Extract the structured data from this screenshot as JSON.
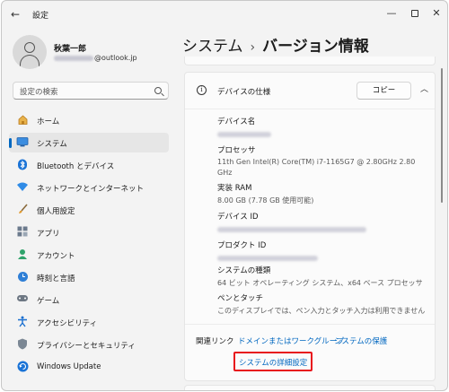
{
  "window": {
    "title": "設定"
  },
  "profile": {
    "name": "秋葉一郎",
    "email_domain": "@outlook.jp"
  },
  "search": {
    "placeholder": "設定の検索"
  },
  "sidebar": {
    "items": [
      {
        "label": "ホーム",
        "icon": "home-icon"
      },
      {
        "label": "システム",
        "icon": "system-icon"
      },
      {
        "label": "Bluetooth とデバイス",
        "icon": "bluetooth-icon"
      },
      {
        "label": "ネットワークとインターネット",
        "icon": "wifi-icon"
      },
      {
        "label": "個人用設定",
        "icon": "brush-icon"
      },
      {
        "label": "アプリ",
        "icon": "apps-icon"
      },
      {
        "label": "アカウント",
        "icon": "account-icon"
      },
      {
        "label": "時刻と言語",
        "icon": "time-language-icon"
      },
      {
        "label": "ゲーム",
        "icon": "gamepad-icon"
      },
      {
        "label": "アクセシビリティ",
        "icon": "accessibility-icon"
      },
      {
        "label": "プライバシーとセキュリティ",
        "icon": "shield-icon"
      },
      {
        "label": "Windows Update",
        "icon": "update-icon"
      }
    ]
  },
  "breadcrumb": {
    "parent": "システム",
    "separator": "›",
    "current": "バージョン情報"
  },
  "device_specs": {
    "title": "デバイスの仕様",
    "copy_label": "コピー",
    "device_name_label": "デバイス名",
    "processor_label": "プロセッサ",
    "processor_line1": "11th Gen Intel(R) Core(TM) i7-1165G7 @ 2.80GHz   2.80",
    "processor_line2": "GHz",
    "ram_label": "実装 RAM",
    "ram_value": "8.00 GB (7.78 GB 使用可能)",
    "device_id_label": "デバイス ID",
    "product_id_label": "プロダクト ID",
    "system_type_label": "システムの種類",
    "system_type_value": "64 ビット オペレーティング システム、x64 ベース プロセッサ",
    "pen_touch_label": "ペンとタッチ",
    "pen_touch_value": "このディスプレイでは、ペン入力とタッチ入力は利用できません"
  },
  "related_links": {
    "label": "関連リンク",
    "domain_link": "ドメインまたはワークグループ",
    "protection_link": "システムの保護",
    "advanced_link": "システムの詳細設定"
  },
  "colors": {
    "accent": "#0067c0",
    "highlight": "#e8141c"
  }
}
